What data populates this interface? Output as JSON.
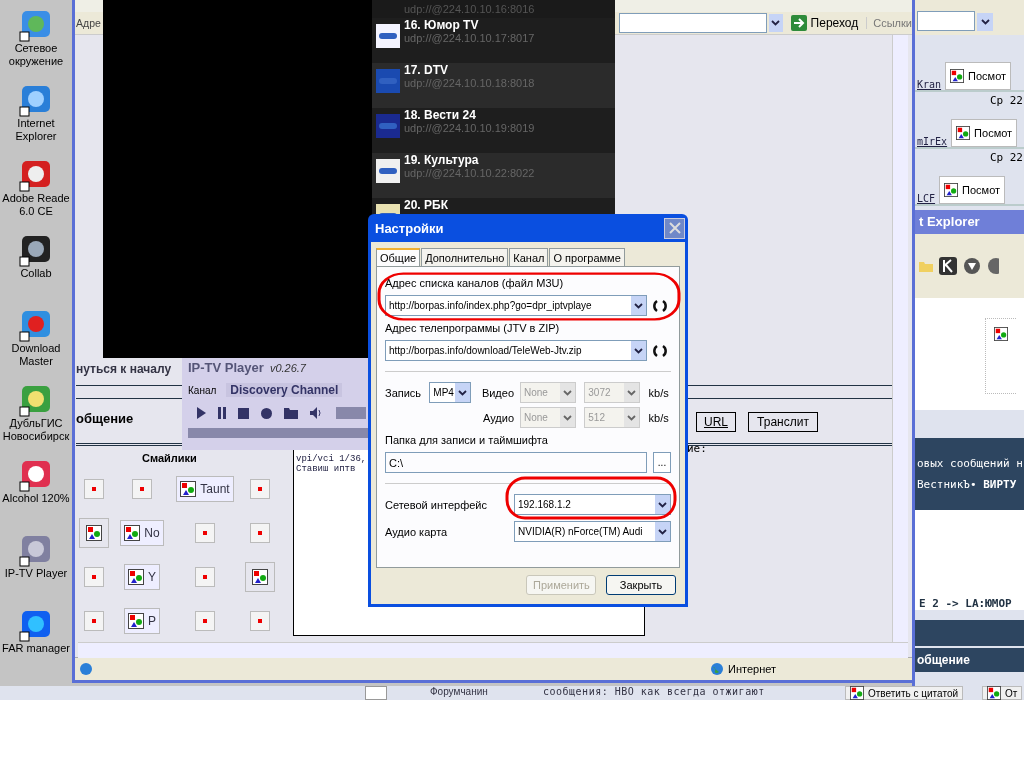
{
  "desktop_icons": [
    {
      "kind": "network",
      "lines": [
        "Сетевое",
        "окружение"
      ]
    },
    {
      "kind": "ie",
      "lines": [
        "Internet",
        "Explorer"
      ]
    },
    {
      "kind": "adobe",
      "lines": [
        "Adobe Reade",
        "6.0 CE"
      ]
    },
    {
      "kind": "collab",
      "lines": [
        "Collab"
      ]
    },
    {
      "kind": "download",
      "lines": [
        "Download",
        "Master"
      ]
    },
    {
      "kind": "gis",
      "lines": [
        "ДубльГИС",
        "Новосибирск"
      ]
    },
    {
      "kind": "alcohol",
      "lines": [
        "Alcohol 120%"
      ]
    },
    {
      "kind": "iptv",
      "lines": [
        "IP-TV Player"
      ]
    },
    {
      "kind": "far",
      "lines": [
        "FAR manager"
      ]
    }
  ],
  "browser_left": {
    "address_label": "Адре",
    "go_button": "Переход",
    "links": "Ссылки",
    "status": "Интернет"
  },
  "channel_list": {
    "partial_address": "udp://@224.10.10.16:8016",
    "channels": [
      {
        "title": "16. Юмор TV",
        "address": "udp://@224.10.10.17:8017",
        "kind": "humor"
      },
      {
        "title": "17. DTV",
        "address": "udp://@224.10.10.18:8018",
        "kind": "dtv"
      },
      {
        "title": "18. Вести 24",
        "address": "udp://@224.10.10.19:8019",
        "kind": "vesti"
      },
      {
        "title": "19. Культура",
        "address": "udp://@224.10.10.22:8022",
        "kind": "kultura"
      },
      {
        "title": "20. РБК",
        "kind": "rbk"
      }
    ]
  },
  "forum": {
    "back_to_top": "нуться к началу",
    "reply_heading": "общение",
    "smileys_heading": "Смайлики",
    "smileys": [
      [
        {
          "kind": "small"
        },
        {
          "kind": "small"
        },
        {
          "kind": "labeled",
          "label": "Taunt"
        },
        {
          "kind": "small"
        }
      ],
      [
        {
          "kind": "image"
        },
        {
          "kind": "labeled",
          "label": "No"
        },
        {
          "kind": "small"
        },
        {
          "kind": "small"
        }
      ],
      [
        {
          "kind": "small"
        },
        {
          "kind": "labeled",
          "label": "Y"
        },
        {
          "kind": "small"
        },
        {
          "kind": "image"
        }
      ],
      [
        {
          "kind": "small"
        },
        {
          "kind": "labeled",
          "label": "P"
        },
        {
          "kind": "small"
        },
        {
          "kind": "small"
        }
      ]
    ],
    "buttons": [
      "URL",
      "Транслит"
    ],
    "message_lines": [
      "vpi/vci 1/36,",
      "Ставиш иптв"
    ],
    "hint": "ие:"
  },
  "player": {
    "name": "IP-TV Player",
    "version": "v0.26.7",
    "channel_label": "Канал",
    "channel": "Discovery Channel"
  },
  "settings": {
    "title": "Настройки",
    "tabs": [
      {
        "label": "Общие",
        "selected": true
      },
      {
        "label": "Дополнительно",
        "selected": false
      },
      {
        "label": "Канал",
        "selected": false
      },
      {
        "label": "О программе",
        "selected": false
      }
    ],
    "playlist_label": "Адрес списка каналов (файл M3U)",
    "playlist_url": "http://borpas.info/index.php?go=dpr_iptvplaye",
    "epg_label": "Адрес телепрограммы (JTV в ZIP)",
    "epg_url": "http://borpas.info/download/TeleWeb-Jtv.zip",
    "record_label": "Запись",
    "record_format": "MP4",
    "codecs_disabled": true,
    "video_label": "Видео",
    "video_codec": "None",
    "video_rate": "3072",
    "video_unit": "kb/s",
    "audio_label": "Аудио",
    "audio_codec": "None",
    "audio_rate": "512",
    "audio_unit": "kb/s",
    "folder_label": "Папка для записи и таймшифта",
    "folder": "C:\\",
    "browse": "...",
    "network_label": "Сетевой интерфейс",
    "network": "192.168.1.2",
    "audio_card_label": "Аудио карта",
    "audio_card": "NVIDIA(R) nForce(TM) Audi",
    "apply": {
      "label": "Применить",
      "disabled": true
    },
    "close": "Закрыть"
  },
  "browser_right": {
    "posts": [
      {
        "user": "Kran",
        "action": "Посмот"
      },
      {
        "date": "Ср 22",
        "user": "mIrEx",
        "action": "Посмот"
      },
      {
        "date": "Ср 22",
        "user": "LCF",
        "action": "Посмот"
      }
    ],
    "title": "t Explorer",
    "band_lines": [
      "овых сообщений н",
      "ВестникЪ• **ВИРТУ**"
    ],
    "forum_line": "E 2 -> LA:ЮМОР",
    "footer": "общение"
  },
  "bottom_strip": {
    "user": "Форумчанин",
    "message": "сообщения: HBO как всегда отжигают",
    "quote_button": "Ответить с цитатой",
    "reply_button": "От"
  }
}
